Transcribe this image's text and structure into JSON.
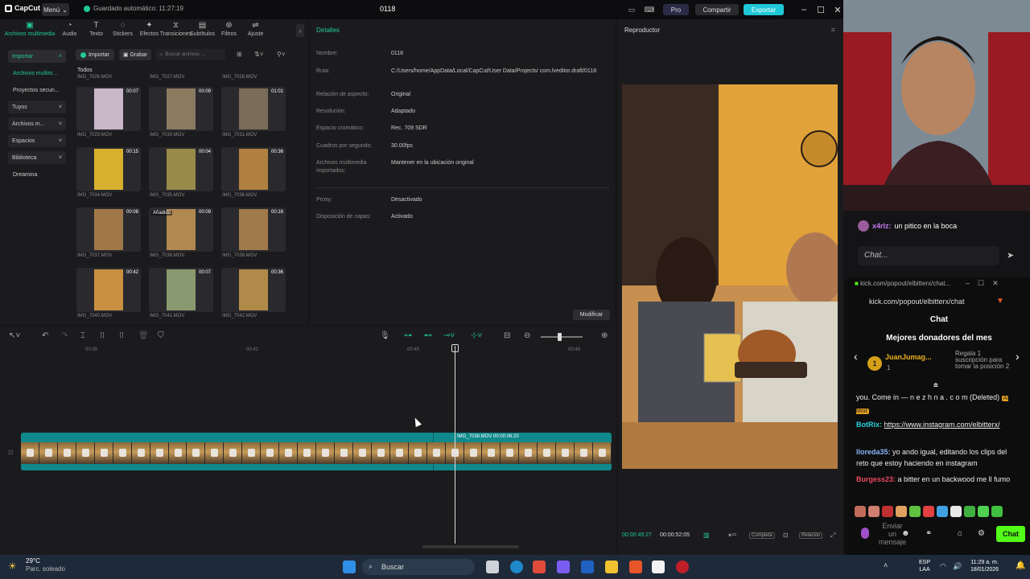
{
  "titlebar": {
    "logo": "CapCut",
    "menu_label": "Menú",
    "autosave": "Guardado automático: 11:27:19",
    "project_title": "0118",
    "pro_label": "Pro",
    "share_label": "Compartir",
    "export_label": "Exportar"
  },
  "toolbar": {
    "items": [
      {
        "label": "Archivos multimedia",
        "icon": "media-icon"
      },
      {
        "label": "Audio",
        "icon": "audio-icon"
      },
      {
        "label": "Texto",
        "icon": "text-icon"
      },
      {
        "label": "Stickers",
        "icon": "sticker-icon"
      },
      {
        "label": "Efectos",
        "icon": "effects-icon"
      },
      {
        "label": "Transiciones",
        "icon": "transition-icon"
      },
      {
        "label": "Subtítulos",
        "icon": "subtitle-icon"
      },
      {
        "label": "Filtros",
        "icon": "filter-icon"
      },
      {
        "label": "Ajuste",
        "icon": "adjust-icon"
      }
    ]
  },
  "sidebar": {
    "import_label": "Importar",
    "items": [
      {
        "label": "Archivos multim..."
      },
      {
        "label": "Proyectos secun..."
      },
      {
        "label": "Tuyos"
      },
      {
        "label": "Archivos m..."
      },
      {
        "label": "Espacios"
      },
      {
        "label": "Biblioteca"
      },
      {
        "label": "Dreamina"
      }
    ]
  },
  "media": {
    "import_btn": "Importar",
    "record_btn": "Grabar",
    "search_placeholder": "Buscar archivos ...",
    "filter_all": "Todos",
    "top_names": [
      "IMG_7026.MOV",
      "IMG_7027.MOV",
      "IMG_7028.MOV"
    ],
    "clips": [
      {
        "name": "IMG_7029.MOV",
        "duration": "00:07",
        "color": "#c9b8c8"
      },
      {
        "name": "IMG_7030.MOV",
        "duration": "00:09",
        "color": "#8a7a60"
      },
      {
        "name": "IMG_7031.MOV",
        "duration": "01:01",
        "color": "#7a6c58"
      },
      {
        "name": "IMG_7034.MOV",
        "duration": "00:15",
        "color": "#d8b030"
      },
      {
        "name": "IMG_7035.MOV",
        "duration": "00:04",
        "color": "#9a8a4a"
      },
      {
        "name": "IMG_7036.MOV",
        "duration": "00:36",
        "color": "#b08040"
      },
      {
        "name": "IMG_7037.MOV",
        "duration": "00:08",
        "color": "#a07848"
      },
      {
        "name": "IMG_7038.MOV",
        "duration": "00:09",
        "color": "#b08850",
        "added": "Añadido"
      },
      {
        "name": "IMG_7039.MOV",
        "duration": "00:16",
        "color": "#a07a4a"
      },
      {
        "name": "IMG_7040.MOV",
        "duration": "00:42",
        "color": "#c89040"
      },
      {
        "name": "IMG_7041.MOV",
        "duration": "00:07",
        "color": "#8a9a70"
      },
      {
        "name": "IMG_7042.MOV",
        "duration": "00:36",
        "color": "#b08a48"
      }
    ]
  },
  "details": {
    "header": "Detalles",
    "rows": [
      {
        "label": "Nombre:",
        "value": "0118"
      },
      {
        "label": "Ruta:",
        "value": "C:/Users/home/AppData/Local/CapCut/User Data/Projects/ com.lveditor.draft/0118"
      },
      {
        "label": "Relación de aspecto:",
        "value": "Original"
      },
      {
        "label": "Resolución:",
        "value": "Adaptado"
      },
      {
        "label": "Espacio cromático:",
        "value": "Rec. 709 SDR"
      },
      {
        "label": "Cuadros por segundo:",
        "value": "30.00fps"
      },
      {
        "label": "Archivos multimedia importados:",
        "value": "Mantener en la ubicación original"
      },
      {
        "label": "Proxy:",
        "value": "Desactivado"
      },
      {
        "label": "Disposición de capas:",
        "value": "Activado"
      }
    ],
    "modify_btn": "Modificar"
  },
  "player": {
    "header": "Reproductor",
    "current_time": "00:00:45:27",
    "total_time": "00:00:52:05",
    "fit_label": "Completa",
    "ratio_label": "Relación"
  },
  "timeline": {
    "ruler": [
      "00:39",
      "00:42",
      "00:45",
      "00:48"
    ],
    "clip_label": "IMG_7038.MOV   00:00:06:20"
  },
  "stream": {
    "top_message_user": "x4rlz:",
    "top_message_text": "un pitico en la boca",
    "chat_placeholder": "Chat...",
    "popout_url_title": "kick.com/popout/elbitterx/chat...",
    "popout_url": "kick.com/popout/elbitterx/chat",
    "chat_title": "Chat",
    "donors_title": "Mejores donadores del mes",
    "donor_name": "JuanJumag...",
    "donor_count": "1",
    "gift_text": "Regala 1 suscripción para tomar la posición 2",
    "messages": [
      {
        "user": "",
        "text": "you. Come in — n e z h n a . c o m (Deleted)",
        "badge": "AI Mod",
        "color": "#ffffff"
      },
      {
        "user": "BotRix:",
        "text": "https://www.instagram.com/elbitterx/",
        "color": "#2ad1e0"
      },
      {
        "user": "lloreda35:",
        "text": "yo ando igual, editando los clips del reto que estoy haciendo en instagram",
        "color": "#8ab4f8"
      },
      {
        "user": "Burgess23:",
        "text": "a bitter en un backwood me ll fumo",
        "color": "#e84a5f"
      }
    ],
    "send_label": "Enviar un mensaje",
    "chat_btn": "Chat"
  },
  "taskbar": {
    "temp": "29°C",
    "weather": "Parc. soleado",
    "search": "Buscar",
    "lang": "ESP",
    "lang2": "LAA",
    "time": "11:29 a. m.",
    "date": "18/01/2026"
  },
  "colors": {
    "accent": "#20c997",
    "export": "#1fc8d8",
    "kick": "#53fc18",
    "track": "#10898c"
  }
}
